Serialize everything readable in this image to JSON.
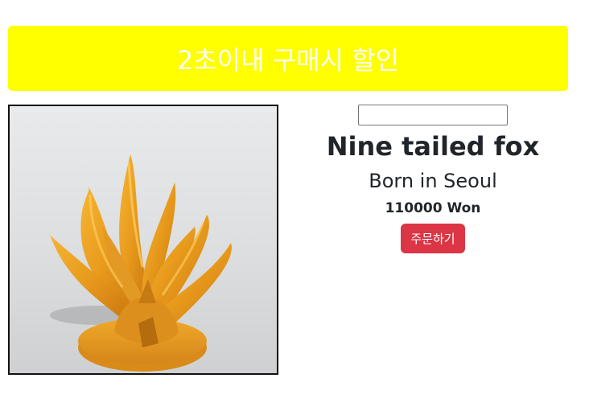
{
  "banner": {
    "text": "2초이내 구매시 할인",
    "background_color": "#ffff00",
    "text_color": "#ffffff"
  },
  "product": {
    "image_icon": "nine-tailed-fox-figurine",
    "name": "Nine tailed fox",
    "origin": "Born in Seoul",
    "price": "110000 Won"
  },
  "search": {
    "value": "",
    "placeholder": ""
  },
  "order": {
    "button_label": "주문하기",
    "button_color": "#dc3545"
  }
}
